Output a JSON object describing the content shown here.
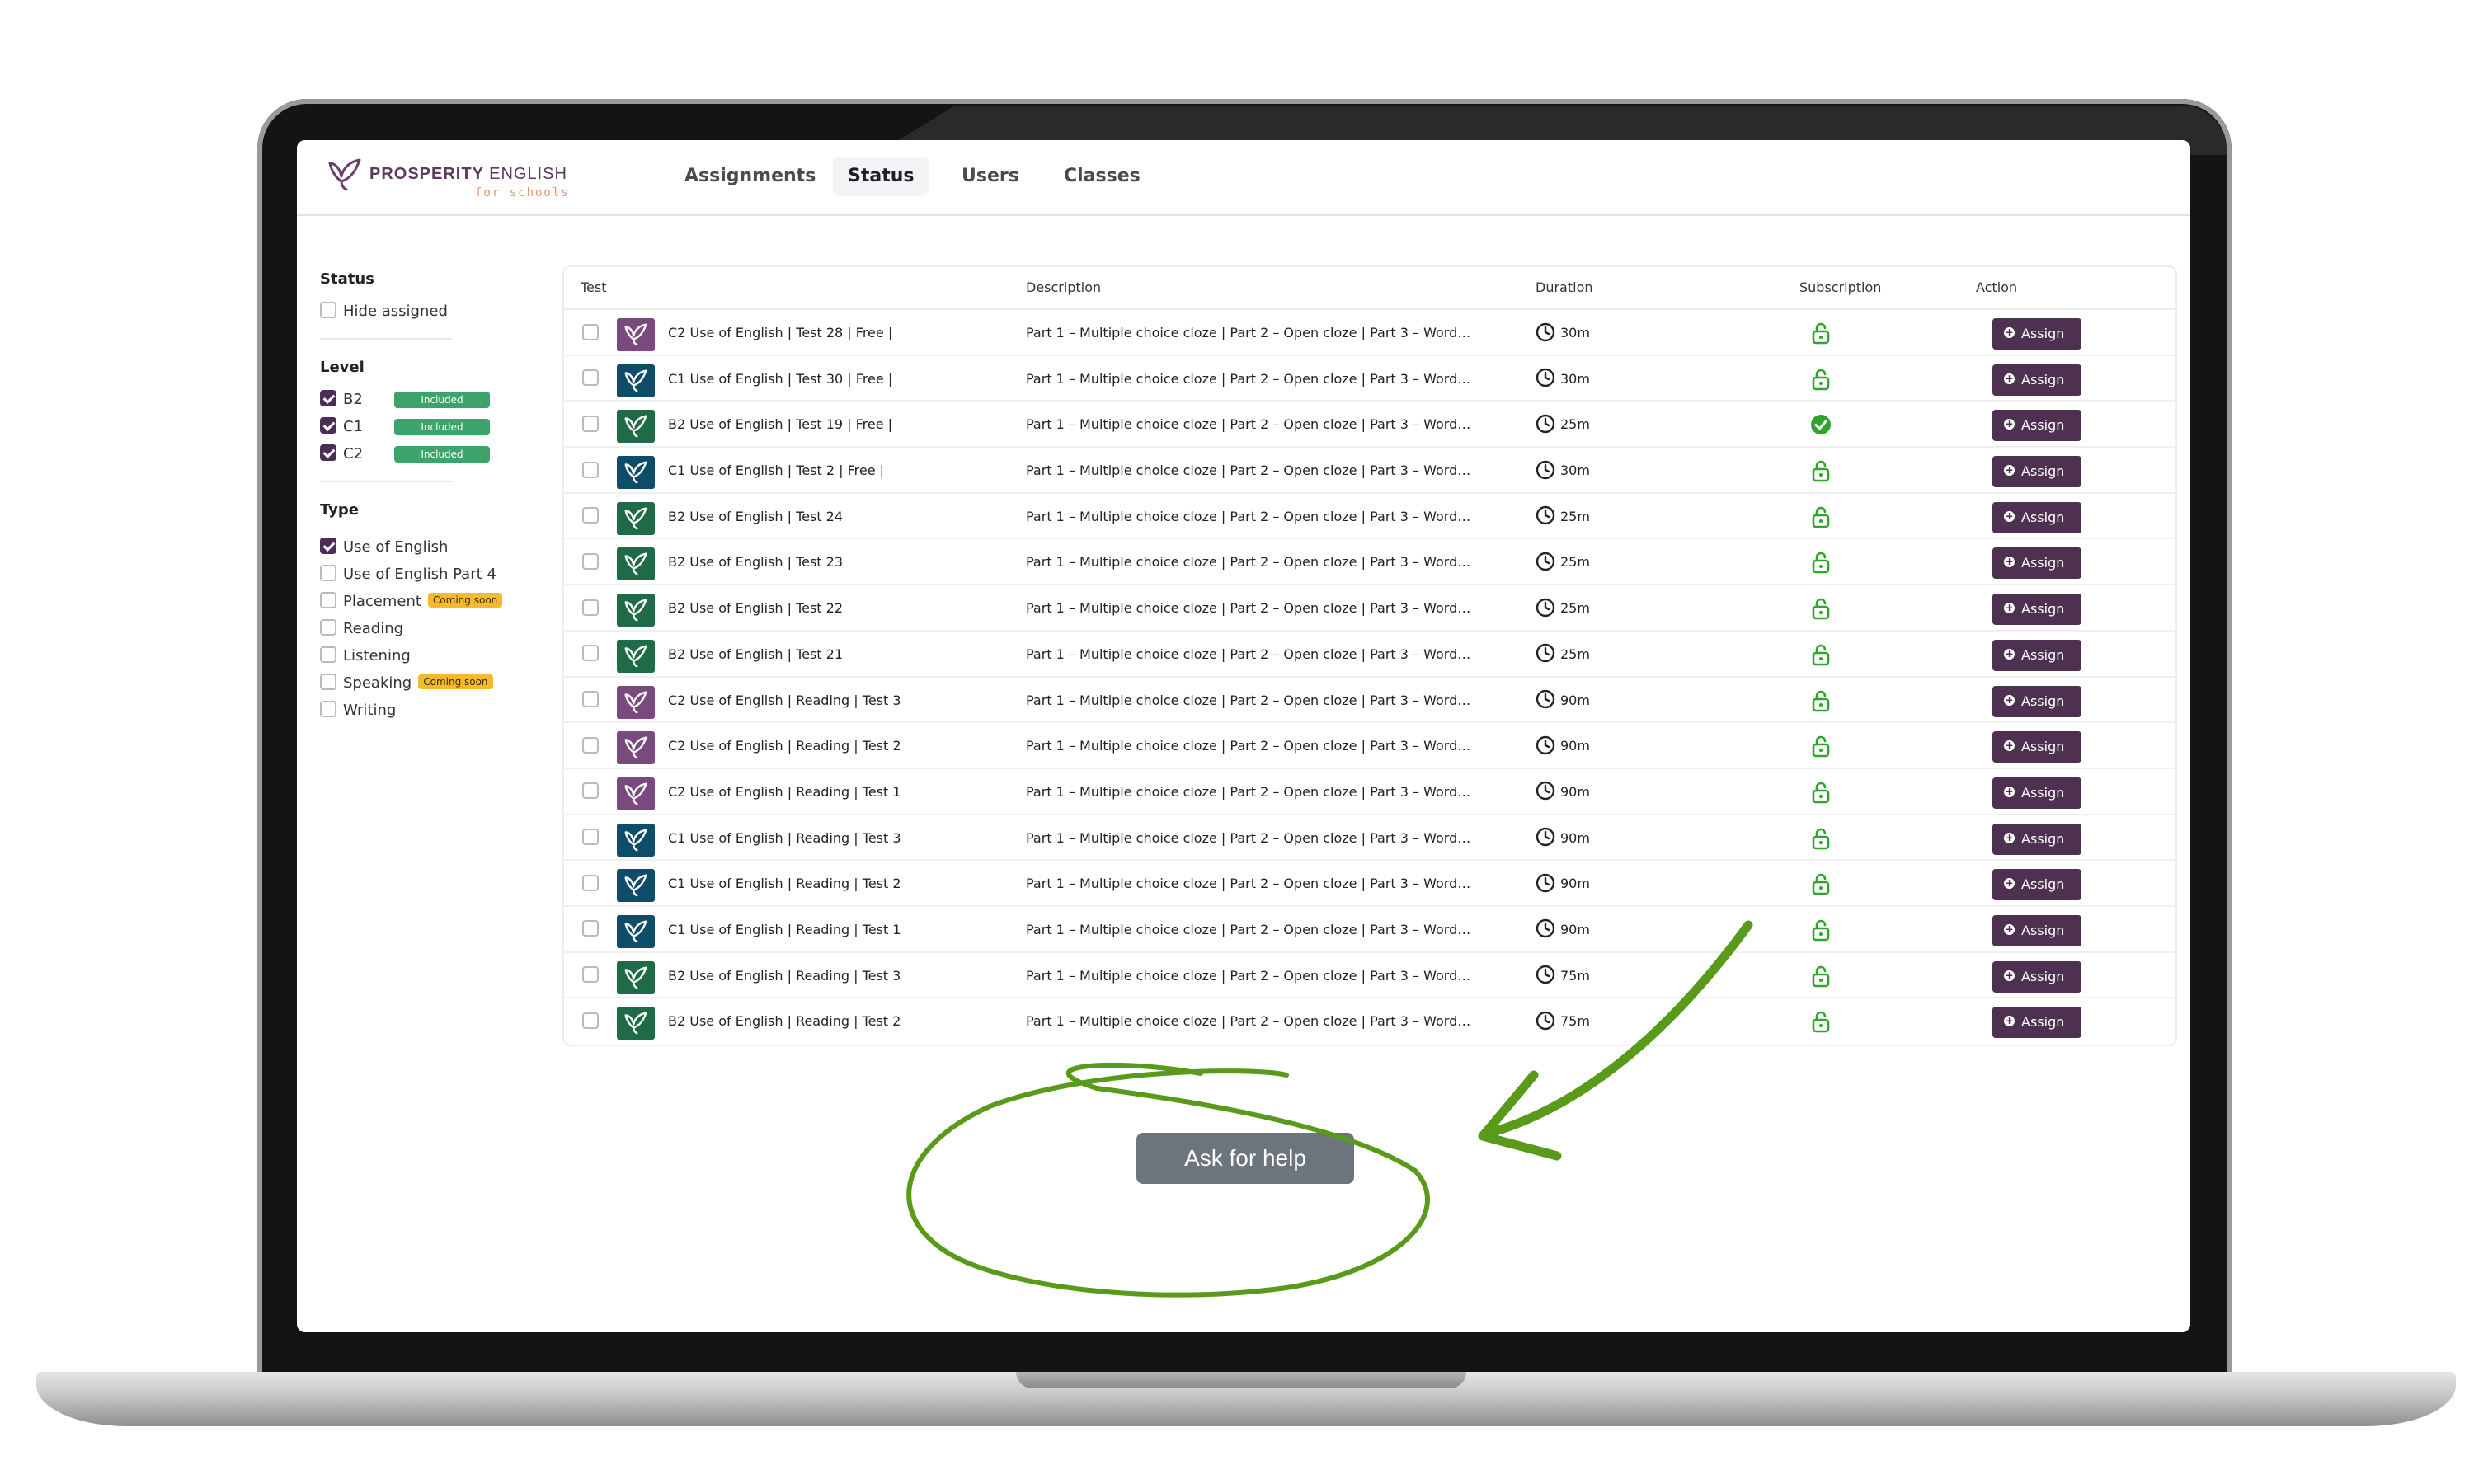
{
  "app": {
    "brand_name": "PROSPERITY",
    "brand_name_2": "ENGLISH",
    "brand_tagline": "for schools"
  },
  "nav": {
    "tabs": [
      {
        "label": "Assignments",
        "active": false
      },
      {
        "label": "Status",
        "active": true
      },
      {
        "label": "Users",
        "active": false
      },
      {
        "label": "Classes",
        "active": false
      }
    ]
  },
  "filters": {
    "status": {
      "heading": "Status",
      "options": [
        {
          "label": "Hide assigned",
          "checked": false
        }
      ]
    },
    "level": {
      "heading": "Level",
      "options": [
        {
          "label": "B2",
          "checked": true,
          "badge": "Included"
        },
        {
          "label": "C1",
          "checked": true,
          "badge": "Included"
        },
        {
          "label": "C2",
          "checked": true,
          "badge": "Included"
        }
      ]
    },
    "type": {
      "heading": "Type",
      "options": [
        {
          "label": "Use of English",
          "checked": true,
          "badge": ""
        },
        {
          "label": "Use of English Part 4",
          "checked": false,
          "badge": ""
        },
        {
          "label": "Placement",
          "checked": false,
          "badge": "Coming soon"
        },
        {
          "label": "Reading",
          "checked": false,
          "badge": ""
        },
        {
          "label": "Listening",
          "checked": false,
          "badge": ""
        },
        {
          "label": "Speaking",
          "checked": false,
          "badge": "Coming soon"
        },
        {
          "label": "Writing",
          "checked": false,
          "badge": ""
        }
      ]
    }
  },
  "table": {
    "columns": {
      "test": "Test",
      "description": "Description",
      "duration": "Duration",
      "subscription": "Subscription",
      "action": "Action"
    },
    "assign_label": "Assign",
    "rows": [
      {
        "level": "c2",
        "name": "C2 Use of English | Test 28 | Free |",
        "description": "Part 1 – Multiple choice cloze | Part 2 – Open cloze | Part 3 – Word…",
        "duration": "30m",
        "subscription": "unlocked"
      },
      {
        "level": "c1",
        "name": "C1 Use of English | Test 30 | Free |",
        "description": "Part 1 – Multiple choice cloze | Part 2 – Open cloze | Part 3 – Word…",
        "duration": "30m",
        "subscription": "unlocked"
      },
      {
        "level": "b2",
        "name": "B2 Use of English | Test 19 | Free |",
        "description": "Part 1 – Multiple choice cloze | Part 2 – Open cloze | Part 3 – Word…",
        "duration": "25m",
        "subscription": "included"
      },
      {
        "level": "c1",
        "name": "C1 Use of English | Test 2 | Free |",
        "description": "Part 1 – Multiple choice cloze | Part 2 – Open cloze | Part 3 – Word…",
        "duration": "30m",
        "subscription": "unlocked"
      },
      {
        "level": "b2",
        "name": "B2 Use of English | Test 24",
        "description": "Part 1 – Multiple choice cloze | Part 2 – Open cloze | Part 3 – Word…",
        "duration": "25m",
        "subscription": "unlocked"
      },
      {
        "level": "b2",
        "name": "B2 Use of English | Test 23",
        "description": "Part 1 – Multiple choice cloze | Part 2 – Open cloze | Part 3 – Word…",
        "duration": "25m",
        "subscription": "unlocked"
      },
      {
        "level": "b2",
        "name": "B2 Use of English | Test 22",
        "description": "Part 1 – Multiple choice cloze | Part 2 – Open cloze | Part 3 – Word…",
        "duration": "25m",
        "subscription": "unlocked"
      },
      {
        "level": "b2",
        "name": "B2 Use of English | Test 21",
        "description": "Part 1 – Multiple choice cloze | Part 2 – Open cloze | Part 3 – Word…",
        "duration": "25m",
        "subscription": "unlocked"
      },
      {
        "level": "c2",
        "name": "C2 Use of English | Reading | Test 3",
        "description": "Part 1 – Multiple choice cloze | Part 2 – Open cloze | Part 3 – Word…",
        "duration": "90m",
        "subscription": "unlocked"
      },
      {
        "level": "c2",
        "name": "C2 Use of English | Reading | Test 2",
        "description": "Part 1 – Multiple choice cloze | Part 2 – Open cloze | Part 3 – Word…",
        "duration": "90m",
        "subscription": "unlocked"
      },
      {
        "level": "c2",
        "name": "C2 Use of English | Reading | Test 1",
        "description": "Part 1 – Multiple choice cloze | Part 2 – Open cloze | Part 3 – Word…",
        "duration": "90m",
        "subscription": "unlocked"
      },
      {
        "level": "c1",
        "name": "C1 Use of English | Reading | Test 3",
        "description": "Part 1 – Multiple choice cloze | Part 2 – Open cloze | Part 3 – Word…",
        "duration": "90m",
        "subscription": "unlocked"
      },
      {
        "level": "c1",
        "name": "C1 Use of English | Reading | Test 2",
        "description": "Part 1 – Multiple choice cloze | Part 2 – Open cloze | Part 3 – Word…",
        "duration": "90m",
        "subscription": "unlocked"
      },
      {
        "level": "c1",
        "name": "C1 Use of English | Reading | Test 1",
        "description": "Part 1 – Multiple choice cloze | Part 2 – Open cloze | Part 3 – Word…",
        "duration": "90m",
        "subscription": "unlocked"
      },
      {
        "level": "b2",
        "name": "B2 Use of English | Reading | Test 3",
        "description": "Part 1 – Multiple choice cloze | Part 2 – Open cloze | Part 3 – Word…",
        "duration": "75m",
        "subscription": "unlocked"
      },
      {
        "level": "b2",
        "name": "B2 Use of English | Reading | Test 2",
        "description": "Part 1 – Multiple choice cloze | Part 2 – Open cloze | Part 3 – Word…",
        "duration": "75m",
        "subscription": "unlocked"
      }
    ]
  },
  "help": {
    "button_label": "Ask for help"
  },
  "colors": {
    "primary": "#4e3050",
    "included_badge": "#3ca46b",
    "coming_soon_badge": "#f4b92c",
    "subscription_icon": "#2fa52b",
    "annotation": "#5a9a1a",
    "help_button": "#6c757d"
  },
  "icons": {
    "logo": "bird-logo-icon",
    "duration": "clock-icon",
    "subscription_unlocked": "unlocked-padlock-icon",
    "subscription_included": "check-circle-icon",
    "assign": "plus-circle-icon"
  }
}
